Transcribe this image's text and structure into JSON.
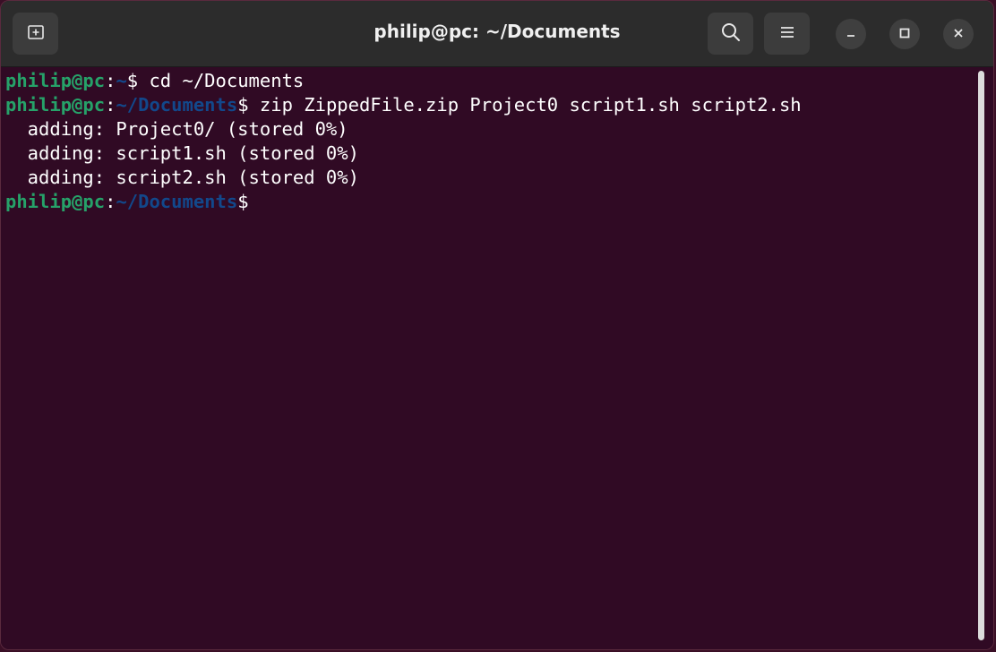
{
  "window": {
    "title": "philip@pc: ~/Documents",
    "buttons": {
      "new_tab": "new-tab-icon",
      "search": "search-icon",
      "menu": "hamburger-menu-icon",
      "minimize": "minimize-icon",
      "maximize": "maximize-icon",
      "close": "close-icon"
    }
  },
  "terminal": {
    "colors": {
      "background": "#300a24",
      "user_host": "#26a269",
      "path": "#12488b",
      "text": "#ffffff"
    },
    "lines": [
      {
        "user": "philip@pc",
        "sep": ":",
        "path": "~",
        "prompt": "$",
        "cmd": " cd ~/Documents"
      },
      {
        "user": "philip@pc",
        "sep": ":",
        "path": "~/Documents",
        "prompt": "$",
        "cmd": " zip ZippedFile.zip Project0 script1.sh script2.sh"
      },
      {
        "output": "  adding: Project0/ (stored 0%)"
      },
      {
        "output": "  adding: script1.sh (stored 0%)"
      },
      {
        "output": "  adding: script2.sh (stored 0%)"
      },
      {
        "user": "philip@pc",
        "sep": ":",
        "path": "~/Documents",
        "prompt": "$",
        "cmd": ""
      }
    ]
  }
}
